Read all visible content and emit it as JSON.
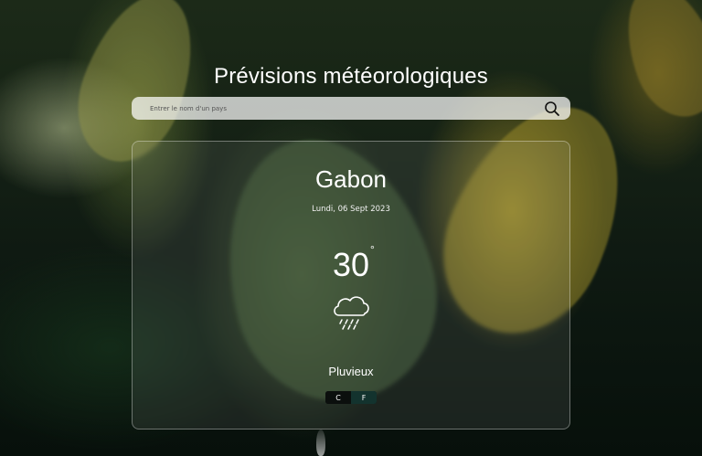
{
  "header": {
    "title": "Prévisions météorologiques"
  },
  "search": {
    "placeholder": "Entrer le nom d'un pays",
    "value": "",
    "icon": "search-icon"
  },
  "weather": {
    "country": "Gabon",
    "date": "Lundi, 06 Sept 2023",
    "temperature": "30",
    "degree_symbol": "°",
    "condition": "Pluvieux",
    "condition_icon": "rain-cloud-icon"
  },
  "units": {
    "celsius_label": "C",
    "fahrenheit_label": "F",
    "selected": "C"
  },
  "colors": {
    "text": "#ffffff",
    "search_bg": "#e6e6e6",
    "toggle_bg": "#0f1715",
    "toggle_alt": "#13332e"
  }
}
